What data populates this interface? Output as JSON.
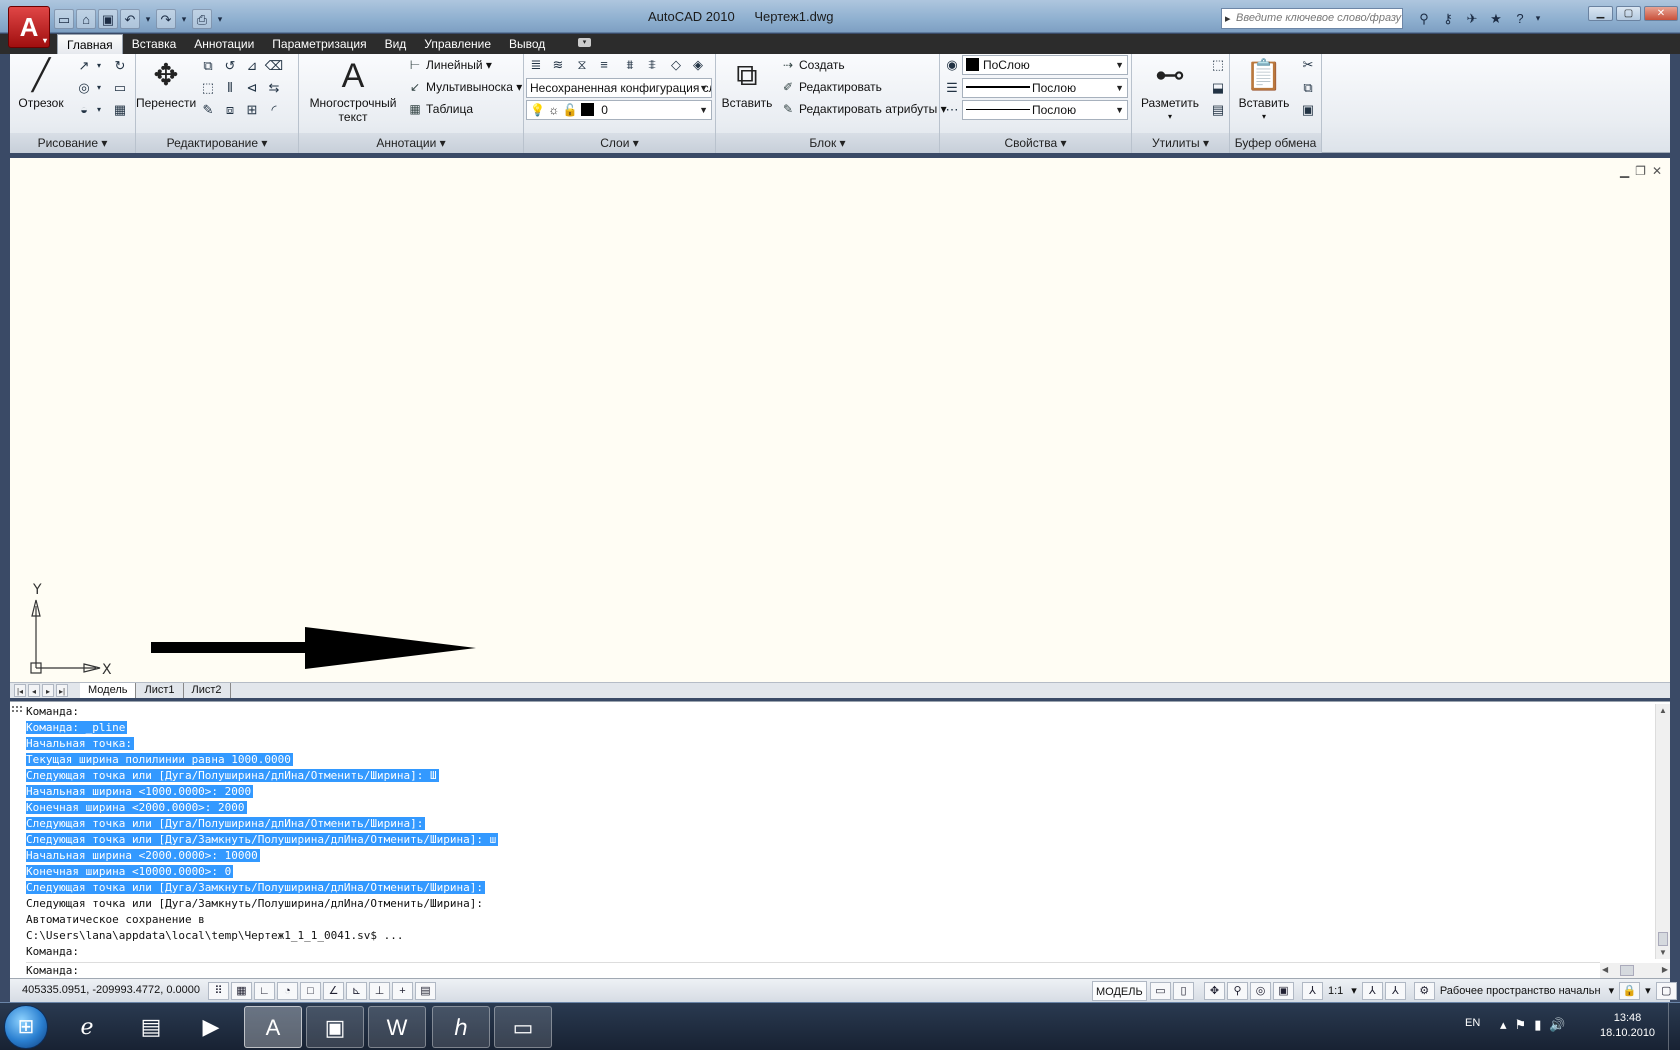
{
  "window": {
    "app_name": "AutoCAD 2010",
    "doc_name": "Чертеж1.dwg",
    "search_placeholder": "Введите ключевое слово/фразу",
    "app_button_letter": "A",
    "qat_icons": [
      "new-icon",
      "open-icon",
      "save-icon",
      "undo-icon",
      "redo-icon",
      "plot-icon",
      "dropdown-icon"
    ],
    "info_icons": [
      "binoculars-icon",
      "key-icon",
      "satellite-icon",
      "star-icon",
      "help-icon"
    ],
    "controls": [
      "minimize",
      "maximize",
      "close"
    ]
  },
  "ribbon_tabs": [
    "Главная",
    "Вставка",
    "Аннотации",
    "Параметризация",
    "Вид",
    "Управление",
    "Вывод"
  ],
  "panels": {
    "draw": {
      "title": "Рисование",
      "line_label": "Отрезок"
    },
    "modify": {
      "title": "Редактирование",
      "move_label": "Перенести"
    },
    "annotation": {
      "title": "Аннотации",
      "mtext_label_1": "Многострочный",
      "mtext_label_2": "текст",
      "mtext_glyph": "A",
      "linear": "Линейный",
      "multileader": "Мультивыноска",
      "table": "Таблица"
    },
    "layers": {
      "title": "Слои",
      "layer_state": "Несохраненная конфигурация сл",
      "current_layer": "0"
    },
    "block": {
      "title": "Блок",
      "insert_label": "Вставить",
      "create": "Создать",
      "edit": "Редактировать",
      "edit_attributes": "Редактировать атрибуты"
    },
    "properties": {
      "title": "Свойства",
      "color": "ПоСлою",
      "lineweight": "Послою",
      "linetype": "Послою"
    },
    "utilities": {
      "title": "Утилиты",
      "measure_label": "Разметить"
    },
    "clipboard": {
      "title": "Буфер обмена",
      "paste_label": "Вставить"
    }
  },
  "drawing": {
    "background": "#fffdf4",
    "ucs_x": "X",
    "ucs_y": "Y"
  },
  "layout_tabs": [
    "Модель",
    "Лист1",
    "Лист2"
  ],
  "command_history": [
    {
      "text": "Команда:",
      "selected": false
    },
    {
      "text": "Команда: _pline",
      "selected": true
    },
    {
      "text": "Начальная точка:",
      "selected": true
    },
    {
      "text": "Текущая ширина полилинии равна 1000.0000",
      "selected": true
    },
    {
      "text": "Следующая точка или [Дуга/Полуширина/длИна/Отменить/Ширина]: Ш",
      "selected": true
    },
    {
      "text": "Начальная ширина <1000.0000>: 2000",
      "selected": true
    },
    {
      "text": "Конечная ширина <2000.0000>: 2000",
      "selected": true
    },
    {
      "text": "Следующая точка или [Дуга/Полуширина/длИна/Отменить/Ширина]:",
      "selected": true
    },
    {
      "text": "Следующая точка или [Дуга/Замкнуть/Полуширина/длИна/Отменить/Ширина]: ш",
      "selected": true
    },
    {
      "text": "Начальная ширина <2000.0000>: 10000",
      "selected": true
    },
    {
      "text": "Конечная ширина <10000.0000>: 0",
      "selected": true
    },
    {
      "text": "Следующая точка или [Дуга/Замкнуть/Полуширина/длИна/Отменить/Ширина]:",
      "selected": true
    },
    {
      "text": "Следующая точка или [Дуга/Замкнуть/Полуширина/длИна/Отменить/Ширина]:",
      "selected": false
    },
    {
      "text": "Автоматическое сохранение в",
      "selected": false
    },
    {
      "text": "C:\\Users\\lana\\appdata\\local\\temp\\Чертеж1_1_1_0041.sv$ ...",
      "selected": false
    },
    {
      "text": "Команда:",
      "selected": false
    }
  ],
  "command_prompt": "Команда:",
  "status": {
    "coordinates": "405335.0951, -209993.4772, 0.0000",
    "model": "МОДЕЛЬ",
    "scale": "1:1",
    "workspace": "Рабочее пространство начальн"
  },
  "taskbar": {
    "apps": [
      "start-orb",
      "ie",
      "explorer",
      "media-player",
      "autocad",
      "save-app",
      "word",
      "hp",
      "display"
    ],
    "language": "EN",
    "time": "13:48",
    "date": "18.10.2010"
  },
  "colors": {
    "accent": "#3399ff",
    "title_bar": "#8fb0d0",
    "tab_bar": "#2c2c2c",
    "canvas": "#fffdf4"
  }
}
